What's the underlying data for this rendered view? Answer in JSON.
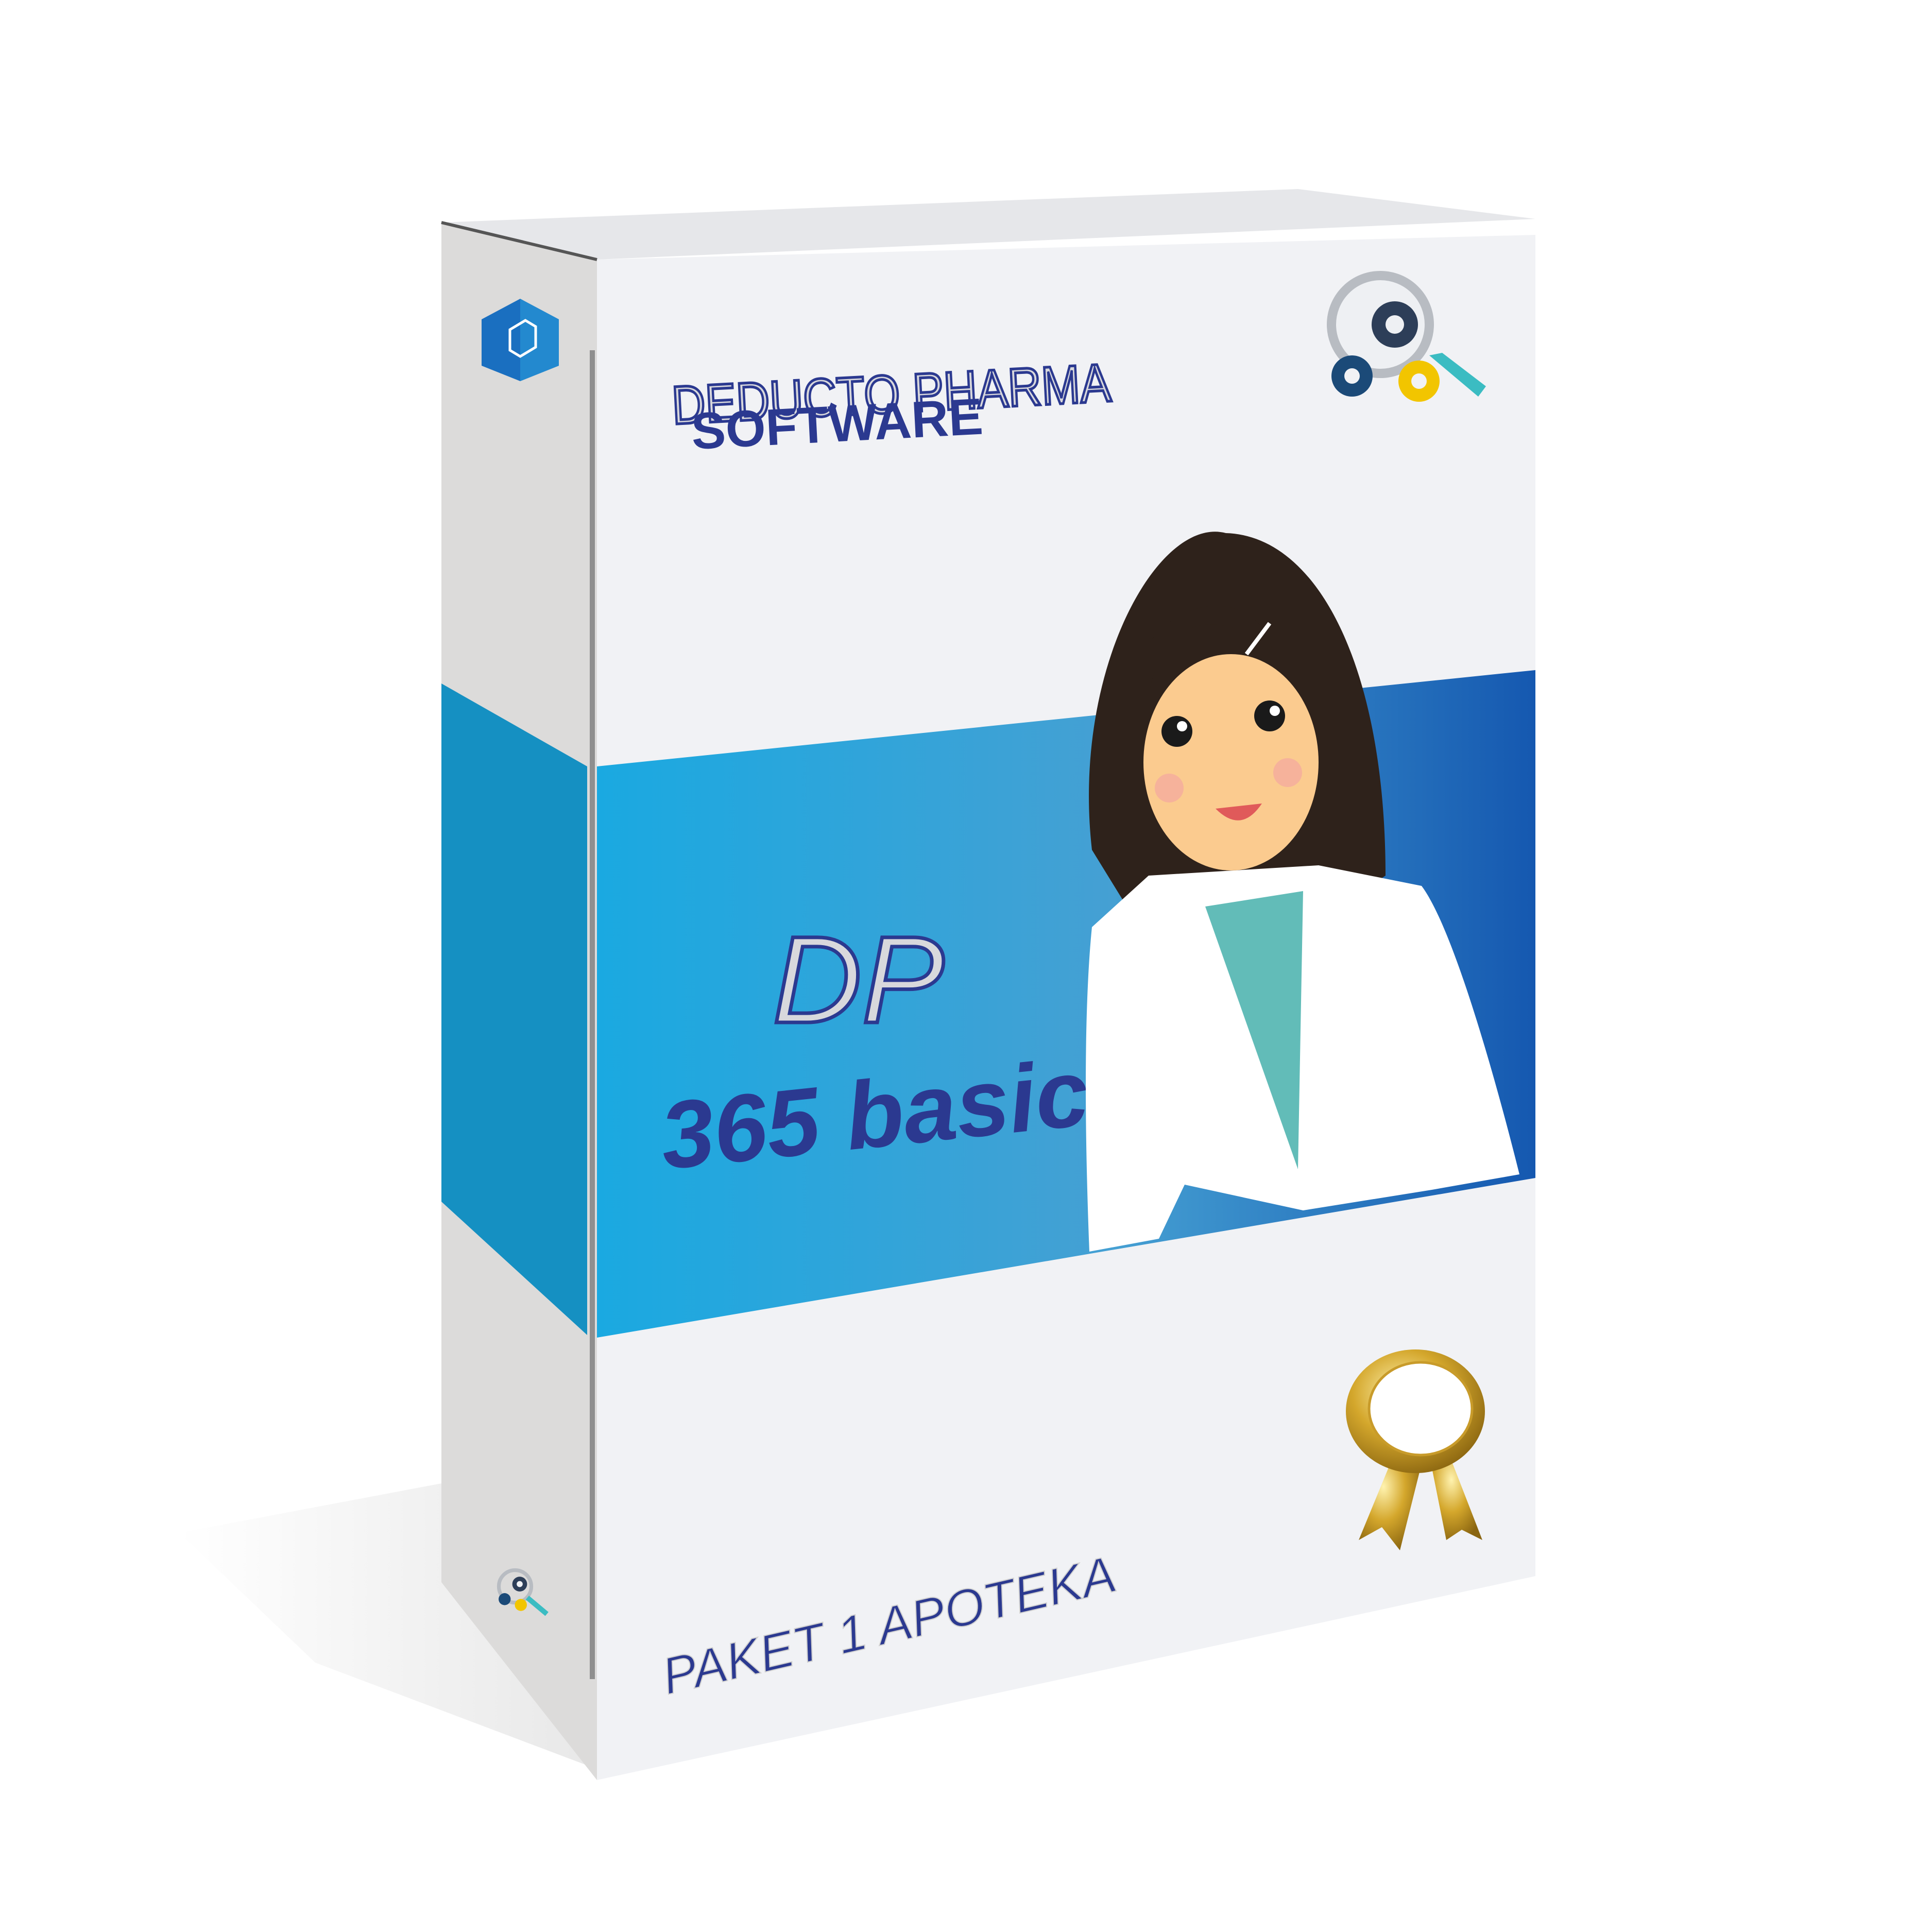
{
  "box": {
    "brand_line": "DEDUCTO PHARMA",
    "sub_line": "SOFTWARE",
    "product_code": "DP",
    "product_name": "365 basic",
    "package": "PAKET 1 APOTEKA"
  },
  "colors": {
    "text_navy": "#2b3990",
    "band_light": "#1aa9e1",
    "band_dark": "#1558b0",
    "spine_band": "#1590c2",
    "face": "#f1f2f5",
    "gold": "#d4a72c"
  },
  "icons": [
    "hexagon-logo-icon",
    "magnifier-gears-icon",
    "award-seal-icon"
  ]
}
